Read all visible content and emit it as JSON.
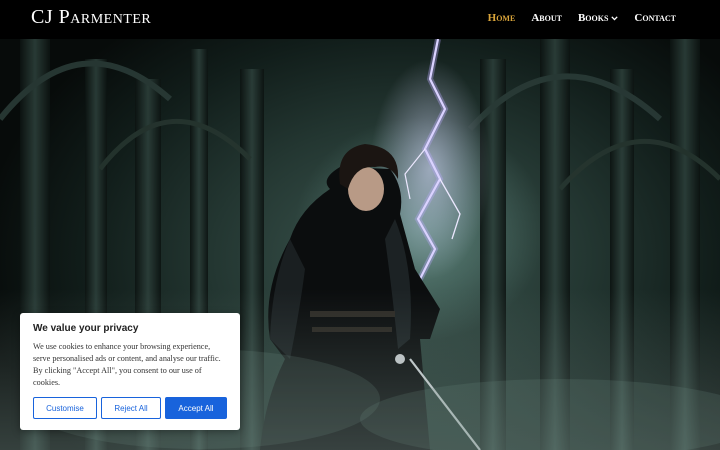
{
  "site": {
    "logo": "CJ Parmenter"
  },
  "nav": {
    "items": [
      {
        "label": "Home",
        "active": true
      },
      {
        "label": "About"
      },
      {
        "label": "Books",
        "has_dropdown": true
      },
      {
        "label": "Contact"
      }
    ]
  },
  "cookie_banner": {
    "title": "We value your privacy",
    "body": "We use cookies to enhance your browsing experience, serve personalised ads or content, and analyse our traffic. By clicking \"Accept All\", you consent to our use of cookies.",
    "buttons": {
      "customise": "Customise",
      "reject": "Reject All",
      "accept": "Accept All"
    }
  },
  "colors": {
    "accent": "#d9a43a",
    "button_blue": "#1863dc",
    "header_bg": "#000000"
  },
  "icons": {
    "dropdown": "chevron-down-icon"
  }
}
